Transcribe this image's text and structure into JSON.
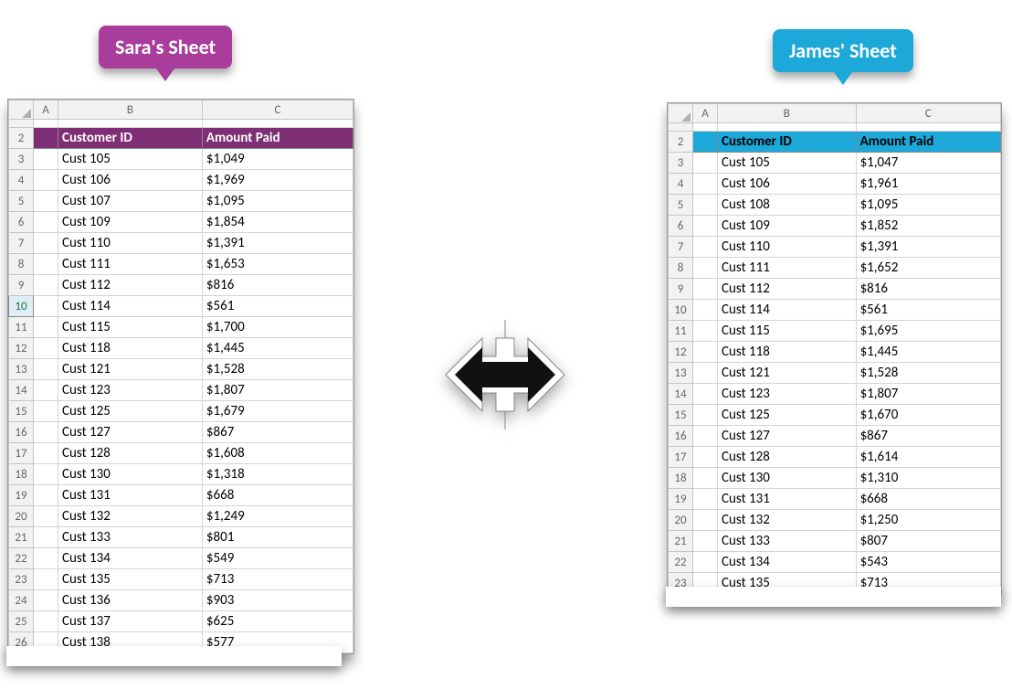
{
  "labels": {
    "sara": "Sara's Sheet",
    "james": "James' Sheet"
  },
  "columns": [
    "A",
    "B",
    "C"
  ],
  "headers": {
    "customer_id": "Customer ID",
    "amount_paid": "Amount Paid"
  },
  "sara": {
    "row_start": 2,
    "selected_rowhdr": 10,
    "rows": [
      {
        "id": "Cust 105",
        "amount": "$1,049"
      },
      {
        "id": "Cust 106",
        "amount": "$1,969"
      },
      {
        "id": "Cust 107",
        "amount": "$1,095"
      },
      {
        "id": "Cust 109",
        "amount": "$1,854"
      },
      {
        "id": "Cust 110",
        "amount": "$1,391"
      },
      {
        "id": "Cust 111",
        "amount": "$1,653"
      },
      {
        "id": "Cust 112",
        "amount": "$816"
      },
      {
        "id": "Cust 114",
        "amount": "$561"
      },
      {
        "id": "Cust 115",
        "amount": "$1,700"
      },
      {
        "id": "Cust 118",
        "amount": "$1,445"
      },
      {
        "id": "Cust 121",
        "amount": "$1,528"
      },
      {
        "id": "Cust 123",
        "amount": "$1,807"
      },
      {
        "id": "Cust 125",
        "amount": "$1,679"
      },
      {
        "id": "Cust 127",
        "amount": "$867"
      },
      {
        "id": "Cust 128",
        "amount": "$1,608"
      },
      {
        "id": "Cust 130",
        "amount": "$1,318"
      },
      {
        "id": "Cust 131",
        "amount": "$668"
      },
      {
        "id": "Cust 132",
        "amount": "$1,249"
      },
      {
        "id": "Cust 133",
        "amount": "$801"
      },
      {
        "id": "Cust 134",
        "amount": "$549"
      },
      {
        "id": "Cust 135",
        "amount": "$713"
      },
      {
        "id": "Cust 136",
        "amount": "$903"
      },
      {
        "id": "Cust 137",
        "amount": "$625"
      },
      {
        "id": "Cust 138",
        "amount": "$577"
      }
    ]
  },
  "james": {
    "row_start": 2,
    "rows": [
      {
        "id": "Cust 105",
        "amount": "$1,047"
      },
      {
        "id": "Cust 106",
        "amount": "$1,961"
      },
      {
        "id": "Cust 108",
        "amount": "$1,095"
      },
      {
        "id": "Cust 109",
        "amount": "$1,852"
      },
      {
        "id": "Cust 110",
        "amount": "$1,391"
      },
      {
        "id": "Cust 111",
        "amount": "$1,652"
      },
      {
        "id": "Cust 112",
        "amount": "$816"
      },
      {
        "id": "Cust 114",
        "amount": "$561"
      },
      {
        "id": "Cust 115",
        "amount": "$1,695"
      },
      {
        "id": "Cust 118",
        "amount": "$1,445"
      },
      {
        "id": "Cust 121",
        "amount": "$1,528"
      },
      {
        "id": "Cust 123",
        "amount": "$1,807"
      },
      {
        "id": "Cust 125",
        "amount": "$1,670"
      },
      {
        "id": "Cust 127",
        "amount": "$867"
      },
      {
        "id": "Cust 128",
        "amount": "$1,614"
      },
      {
        "id": "Cust 130",
        "amount": "$1,310"
      },
      {
        "id": "Cust 131",
        "amount": "$668"
      },
      {
        "id": "Cust 132",
        "amount": "$1,250"
      },
      {
        "id": "Cust 133",
        "amount": "$807"
      },
      {
        "id": "Cust 134",
        "amount": "$543"
      },
      {
        "id": "Cust 135",
        "amount": "$713"
      }
    ]
  }
}
